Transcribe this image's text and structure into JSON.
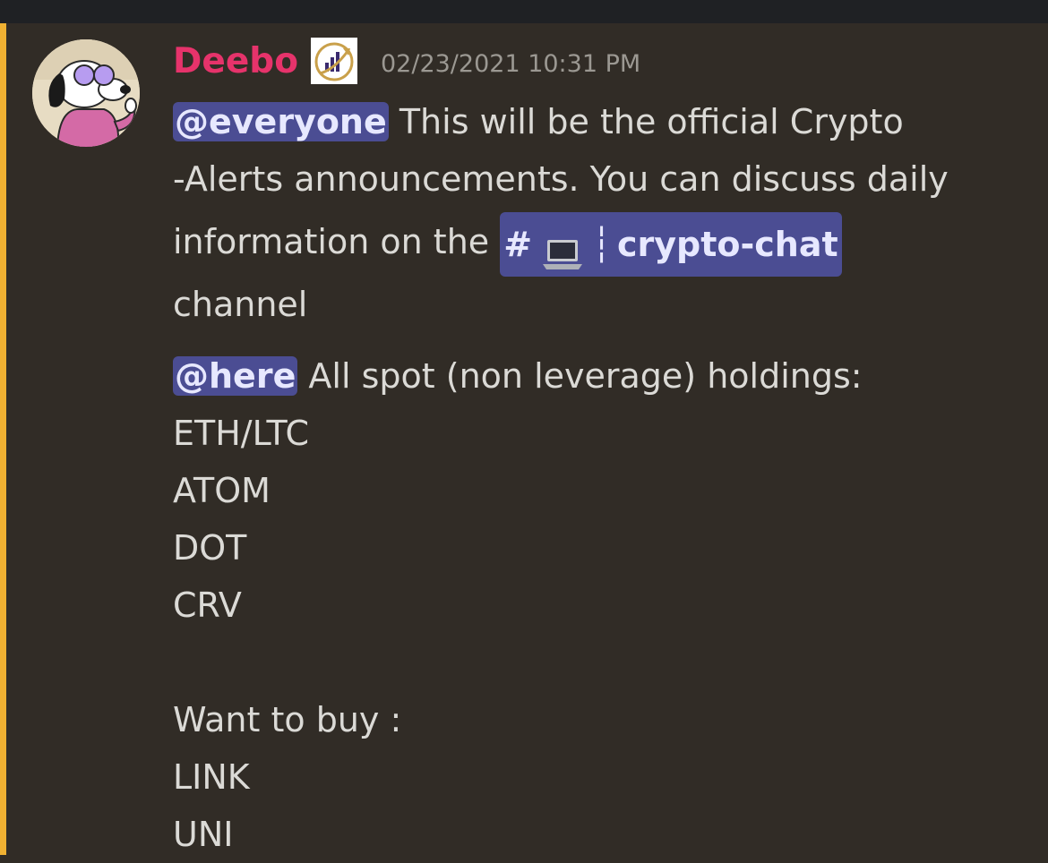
{
  "message": {
    "username": "Deebo",
    "timestamp": "02/23/2021 10:31 PM",
    "line1_mention": "@everyone",
    "line1_text": " This will be the official Crypto",
    "line2_text": "-Alerts announcements. You can discuss daily",
    "line3_text": "information on the ",
    "channel_hash": "#",
    "channel_sep": "┆",
    "channel_name": "crypto-chat",
    "line4_text": "channel",
    "here_mention": "@here",
    "here_text": " All spot (non leverage) holdings:",
    "holdings": [
      "ETH/LTC",
      "ATOM",
      "DOT",
      "CRV"
    ],
    "want_label": "Want to buy :",
    "want": [
      "LINK",
      "UNI"
    ]
  },
  "colors": {
    "accent_bar": "#f0b132",
    "username": "#e6336b",
    "mention_bg": "#4b4d93",
    "background": "#312c26"
  }
}
